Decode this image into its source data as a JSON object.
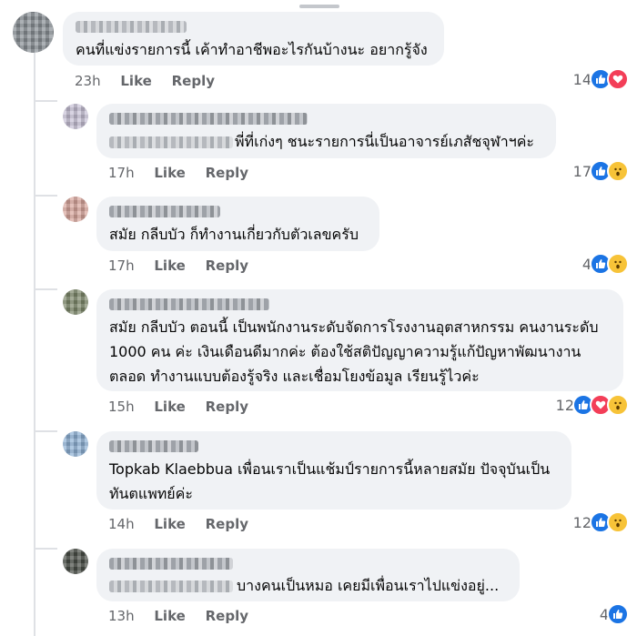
{
  "comments": [
    {
      "line1": "คนที่แข่งรายการนี้ เค้าทำอาชีพอะไรกันบ้างนะ อยากรู้จัง",
      "time": "23h",
      "like": "Like",
      "reply": "Reply",
      "count": "14"
    },
    {
      "line1": "พี่ที่เก่งๆ ชนะรายการนี่เป็นอาจารย์เภสัชจุฬาฯค่ะ",
      "time": "17h",
      "like": "Like",
      "reply": "Reply",
      "count": "17"
    },
    {
      "line1": "สมัย กลีบบัว ก็ทำงานเกี่ยวกับตัวเลขครับ",
      "time": "17h",
      "like": "Like",
      "reply": "Reply",
      "count": "4"
    },
    {
      "line1": "สมัย กลีบบัว ตอนนี้ เป็นพนักงานระดับจัดการโรงงานอุตสาหกรรม คนงานระดับ",
      "line2": "1000 คน ค่ะ เงินเดือนดีมากค่ะ ต้องใช้สติปัญญาความรู้แก้ปัญหาพัฒนางาน",
      "line3": "ตลอด ทำงานแบบต้องรู้จริง  และเชื่อมโยงข้อมูล เรียนรู้ไวค่ะ",
      "time": "15h",
      "like": "Like",
      "reply": "Reply",
      "count": "12"
    },
    {
      "line1": "Topkab Klaebbua เพื่อนเราเป็นแช้มป์รายการนี้หลายสมัย ปัจจุบันเป็น",
      "line2": "ทันตแพทย์ค่ะ",
      "time": "14h",
      "like": "Like",
      "reply": "Reply",
      "count": "12"
    },
    {
      "line1": "บางคนเป็นหมอ เคยมีเพื่อนเราไปแข่งอยู่...",
      "time": "13h",
      "like": "Like",
      "reply": "Reply",
      "count": "4"
    }
  ],
  "colors": {
    "like": "#1b74e4",
    "love": "#f33e58",
    "wow": "#f7c338",
    "bubble": "#f0f2f5",
    "meta": "#65676b"
  },
  "icons": [
    "like-icon",
    "love-icon",
    "wow-icon"
  ]
}
